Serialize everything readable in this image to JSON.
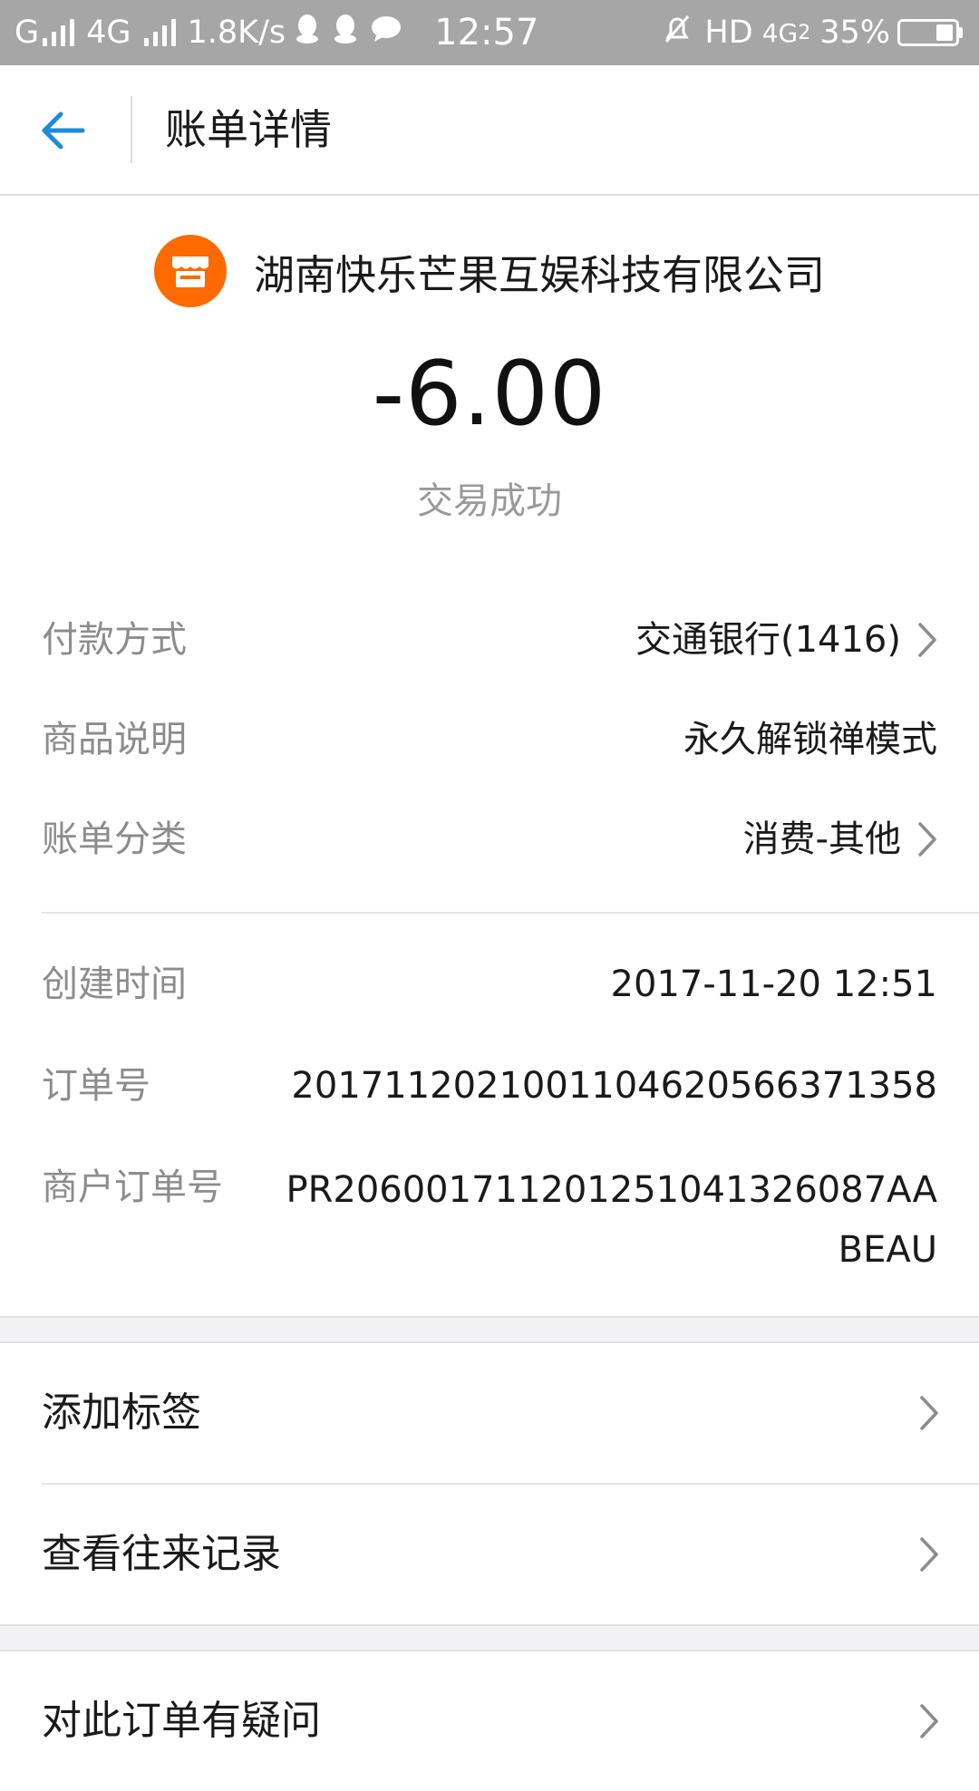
{
  "status_bar": {
    "carrier_left": "G",
    "network": "4G",
    "speed": "1.8K/s",
    "time": "12:57",
    "hd": "HD",
    "network_right": "4G",
    "network_right_sub": "2",
    "battery": "35%",
    "icons": [
      "signal-icon",
      "qq-icon",
      "qq-icon",
      "message-icon",
      "silent-icon",
      "charging-icon"
    ]
  },
  "header": {
    "title": "账单详情",
    "back_icon": "back-arrow-icon"
  },
  "merchant": {
    "name": "湖南快乐芒果互娱科技有限公司",
    "logo_icon": "shop-icon",
    "logo_color": "#ff6a00"
  },
  "amount": "-6.00",
  "status": "交易成功",
  "details": {
    "payment_method": {
      "label": "付款方式",
      "value": "交通银行(1416)"
    },
    "product_desc": {
      "label": "商品说明",
      "value": "永久解锁禅模式"
    },
    "bill_category": {
      "label": "账单分类",
      "value": "消费-其他"
    },
    "created_time": {
      "label": "创建时间",
      "value": "2017-11-20 12:51"
    },
    "order_no": {
      "label": "订单号",
      "value": "20171120210011046205663713​58"
    },
    "merchant_order_no": {
      "label": "商户订单号",
      "value": "PR206001711201251041326087AABEAU"
    }
  },
  "actions": {
    "add_tag": "添加标签",
    "view_history": "查看往来记录",
    "question": "对此订单有疑问"
  },
  "colors": {
    "accent": "#1a8cdc",
    "status_bar": "#a6a6a6",
    "separator": "#f2f2f5"
  }
}
